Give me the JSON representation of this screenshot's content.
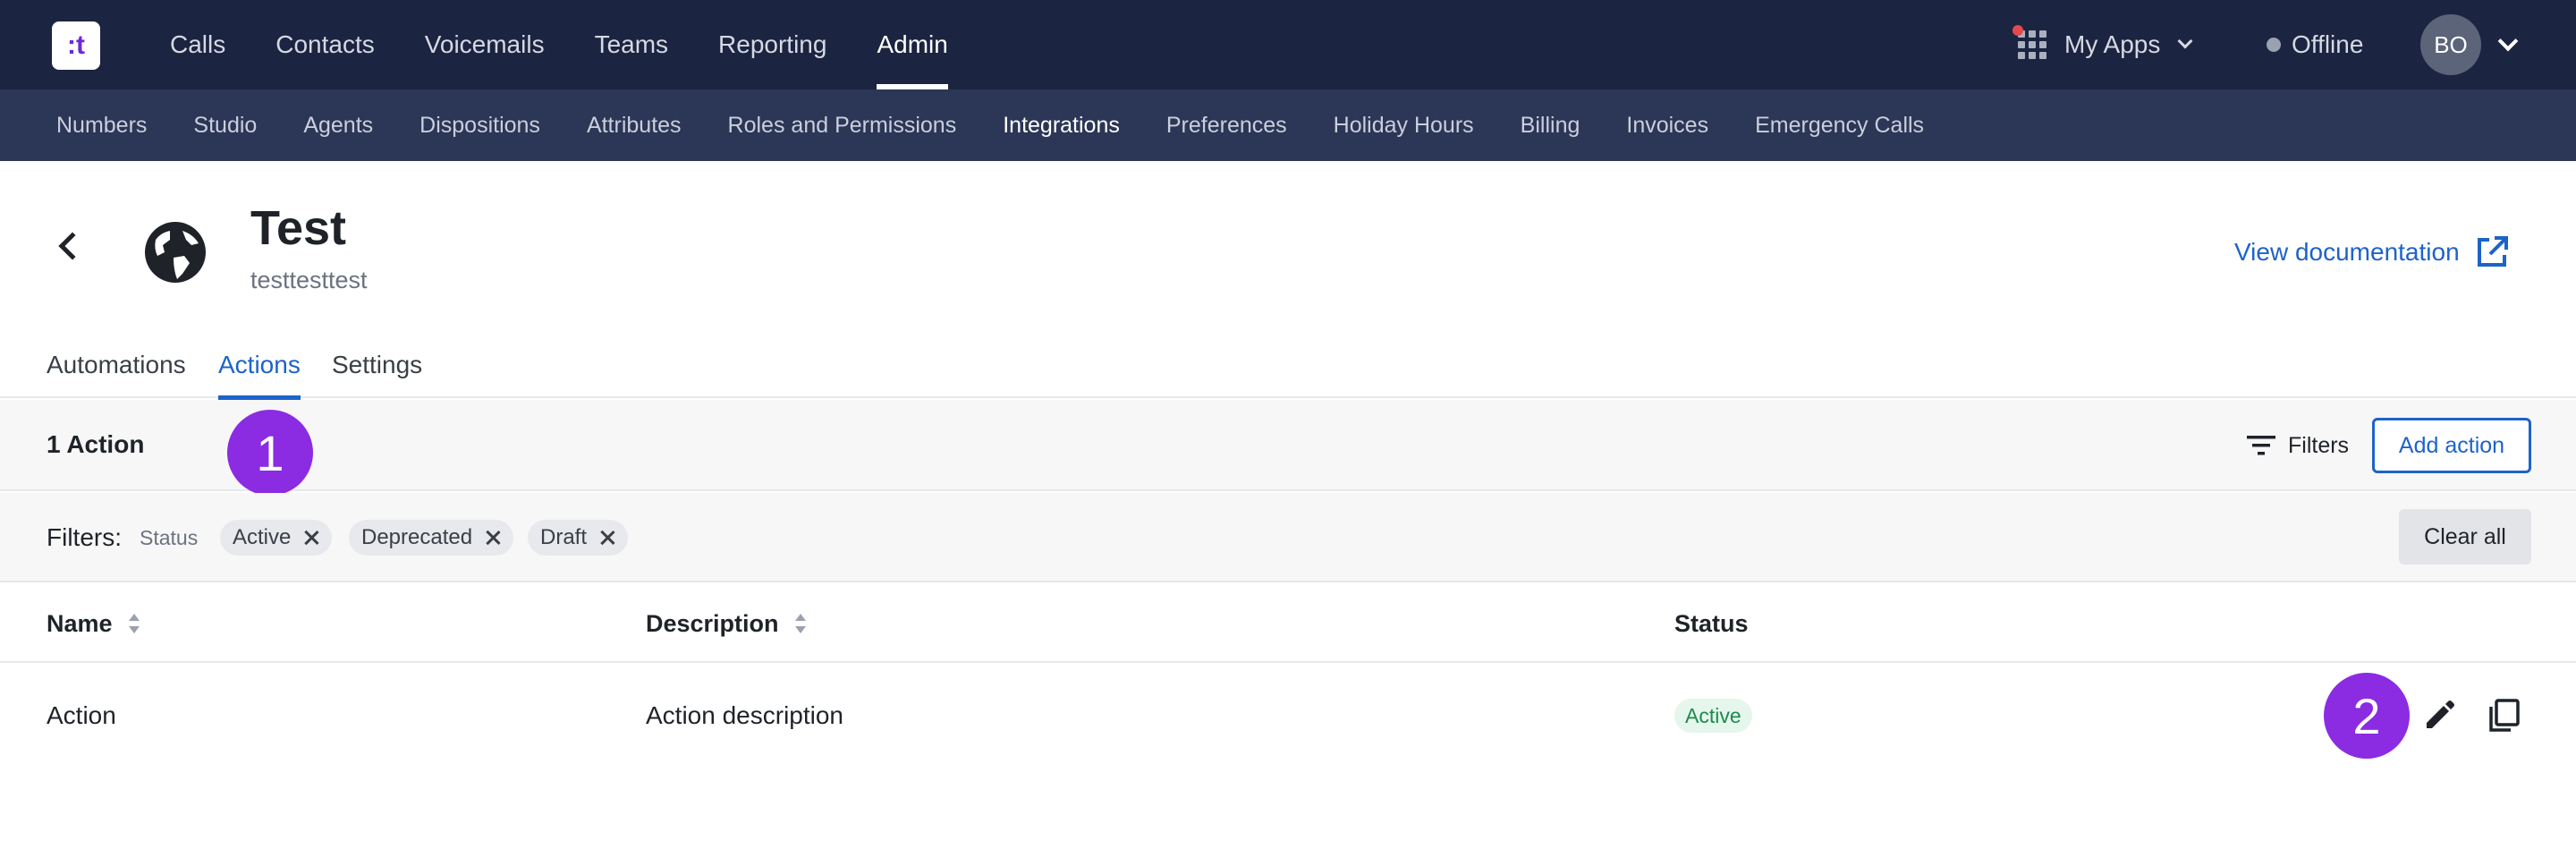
{
  "app": {
    "logo_text": ":t"
  },
  "top_nav": [
    {
      "label": "Calls"
    },
    {
      "label": "Contacts"
    },
    {
      "label": "Voicemails"
    },
    {
      "label": "Teams"
    },
    {
      "label": "Reporting"
    },
    {
      "label": "Admin",
      "active": true
    }
  ],
  "top_right": {
    "my_apps_label": "My Apps",
    "status_label": "Offline",
    "avatar_initials": "BO"
  },
  "sub_nav": [
    {
      "label": "Numbers"
    },
    {
      "label": "Studio"
    },
    {
      "label": "Agents"
    },
    {
      "label": "Dispositions"
    },
    {
      "label": "Attributes"
    },
    {
      "label": "Roles and Permissions"
    },
    {
      "label": "Integrations",
      "active": true
    },
    {
      "label": "Preferences"
    },
    {
      "label": "Holiday Hours"
    },
    {
      "label": "Billing"
    },
    {
      "label": "Invoices"
    },
    {
      "label": "Emergency Calls"
    }
  ],
  "header": {
    "title": "Test",
    "subtitle": "testtesttest",
    "doc_link": "View documentation",
    "icon": "globe-icon"
  },
  "tabs": [
    {
      "label": "Automations"
    },
    {
      "label": "Actions",
      "active": true
    },
    {
      "label": "Settings"
    }
  ],
  "action_bar": {
    "count_label": "1 Action",
    "filters_label": "Filters",
    "add_label": "Add action"
  },
  "filters": {
    "label": "Filters:",
    "group": "Status",
    "chips": [
      "Active",
      "Deprecated",
      "Draft"
    ],
    "clear_label": "Clear all"
  },
  "table": {
    "columns": [
      "Name",
      "Description",
      "Status"
    ],
    "rows": [
      {
        "name": "Action",
        "description": "Action description",
        "status": "Active"
      }
    ]
  },
  "annotations": [
    "1",
    "2"
  ],
  "colors": {
    "topbar": "#1b2440",
    "subnav": "#2c3656",
    "accent": "#1d63c9",
    "badge": "#8b2be2",
    "active_status": "#1e8a4c"
  }
}
